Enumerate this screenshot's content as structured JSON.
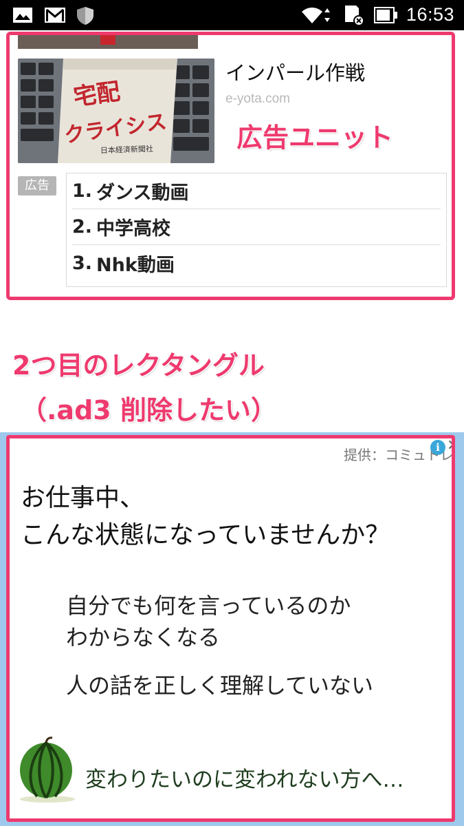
{
  "status_bar": {
    "time": "16:53",
    "left_icons": [
      "gallery-icon",
      "gmail-icon",
      "shield-icon"
    ],
    "right_icons": [
      "wifi-icon",
      "sd-card-icon",
      "battery-icon"
    ]
  },
  "ad_unit": {
    "title": "インパール作戦",
    "domain": "e-yota.com",
    "annotation": "広告ユニット",
    "badge": "広告",
    "links": [
      {
        "num": "1.",
        "text": "ダンス動画"
      },
      {
        "num": "2.",
        "text": "中学高校"
      },
      {
        "num": "3.",
        "text": "Nhk動画"
      }
    ],
    "thumbnail": {
      "book_title": "宅配クライシス",
      "publisher": "日本経済新聞社"
    }
  },
  "annotation": {
    "line1": "2つ目のレクタングル",
    "line2": "（.ad3 削除したい）"
  },
  "rect_ad": {
    "provided_by": "提供：コミュトレ",
    "headline_line1": "お仕事中、",
    "headline_line2": "こんな状態になっていませんか？",
    "body_line1": "自分でも何を言っているのか",
    "body_line2": "わからなくなる",
    "body_line3": "人の話を正しく理解していない",
    "footer": "変わりたいのに変われない方へ…"
  },
  "colors": {
    "annotation_pink": "#ee3a6e",
    "frame_blue": "#9ec9ec",
    "info_blue": "#3aa7d9"
  }
}
